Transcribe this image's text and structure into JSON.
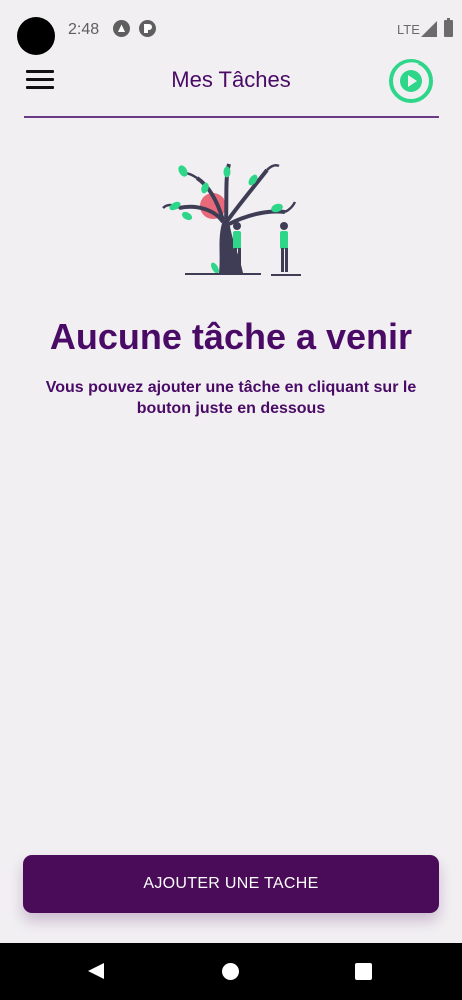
{
  "status_bar": {
    "time": "2:48",
    "network": "LTE",
    "icons": [
      "camera-cutout",
      "react-dev-icon",
      "app-notification-icon",
      "signal-icon",
      "battery-icon"
    ]
  },
  "header": {
    "title": "Mes Tâches",
    "menu_icon": "hamburger-menu-icon",
    "action_icon": "play-circle-icon"
  },
  "empty_state": {
    "illustration": "tree-with-two-people",
    "title": "Aucune tâche a venir",
    "subtitle": "Vous pouvez ajouter une tâche en cliquant sur le bouton juste en dessous"
  },
  "actions": {
    "add_button_label": "AJOUTER UNE TACHE"
  },
  "navigation_bar": {
    "items": [
      "back-icon",
      "home-icon",
      "recents-icon"
    ]
  },
  "colors": {
    "primary": "#4a0b66",
    "button": "#4a0b58",
    "accent_green": "#2ed68a",
    "background": "#f1eff2"
  }
}
